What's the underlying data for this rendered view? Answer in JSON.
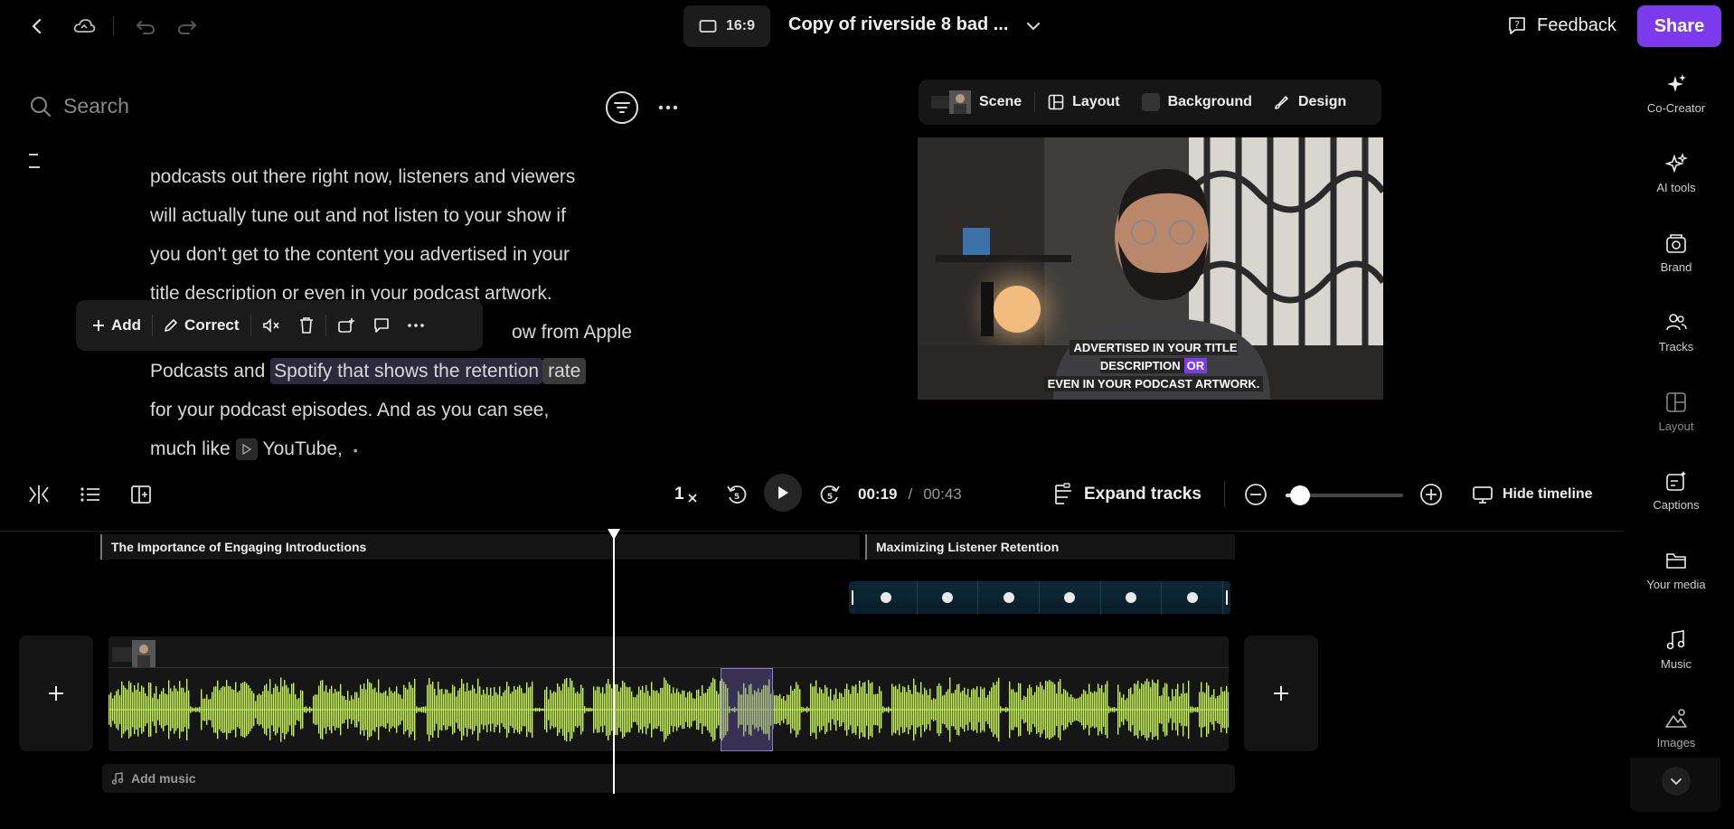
{
  "header": {
    "aspect_ratio": "16:9",
    "project_title": "Copy of riverside 8 bad ...",
    "feedback_label": "Feedback",
    "share_label": "Share"
  },
  "search": {
    "placeholder": "Search"
  },
  "transcript": {
    "lines": [
      "podcasts out there right now,  listeners and viewers",
      "will actually tune out and not listen to your show if",
      "you don't get to the content you advertised in your",
      "title description or even in your podcast artwork."
    ],
    "line5_suffix": "ow from Apple",
    "line6_prefix": "Podcasts and ",
    "line6_selected": "Spotify that shows the retention",
    "line6_word": "rate",
    "line7": "for your podcast episodes. And as you can see,",
    "line8_prefix": "much like ",
    "line8_word": "YouTube,",
    "line8_bullet": "•"
  },
  "toolbar": {
    "add_label": "Add",
    "correct_label": "Correct"
  },
  "scene_bar": {
    "scene_label": "Scene",
    "layout_label": "Layout",
    "background_label": "Background",
    "design_label": "Design"
  },
  "video": {
    "caption_line1_a": "ADVERTISED IN YOUR TITLE DESCRIPTION",
    "caption_line1_hl": "OR",
    "caption_line2": "EVEN IN YOUR PODCAST ARTWORK."
  },
  "rail": {
    "items": [
      {
        "label": "Co-Creator",
        "icon": "sparkle-icon"
      },
      {
        "label": "AI tools",
        "icon": "ai-tools-icon"
      },
      {
        "label": "Brand",
        "icon": "brand-icon"
      },
      {
        "label": "Tracks",
        "icon": "users-icon"
      },
      {
        "label": "Layout",
        "icon": "layout-icon"
      },
      {
        "label": "Captions",
        "icon": "captions-icon"
      },
      {
        "label": "Your media",
        "icon": "folder-icon"
      },
      {
        "label": "Music",
        "icon": "music-icon"
      },
      {
        "label": "Images",
        "icon": "image-icon"
      }
    ]
  },
  "playback": {
    "speed": "1",
    "current_time": "00:19",
    "separator": "/",
    "total_time": "00:43",
    "expand_tracks_label": "Expand tracks",
    "hide_timeline_label": "Hide timeline",
    "zoom_level": 0.1
  },
  "timeline": {
    "chapter1": "The Importance of Engaging Introductions",
    "chapter2": "Maximizing Listener Retention",
    "add_music_label": "Add music",
    "playhead_time": "00:19"
  },
  "colors": {
    "accent": "#7c3aed",
    "waveform": "#c6f35a",
    "selection": "#2d2a3d"
  }
}
